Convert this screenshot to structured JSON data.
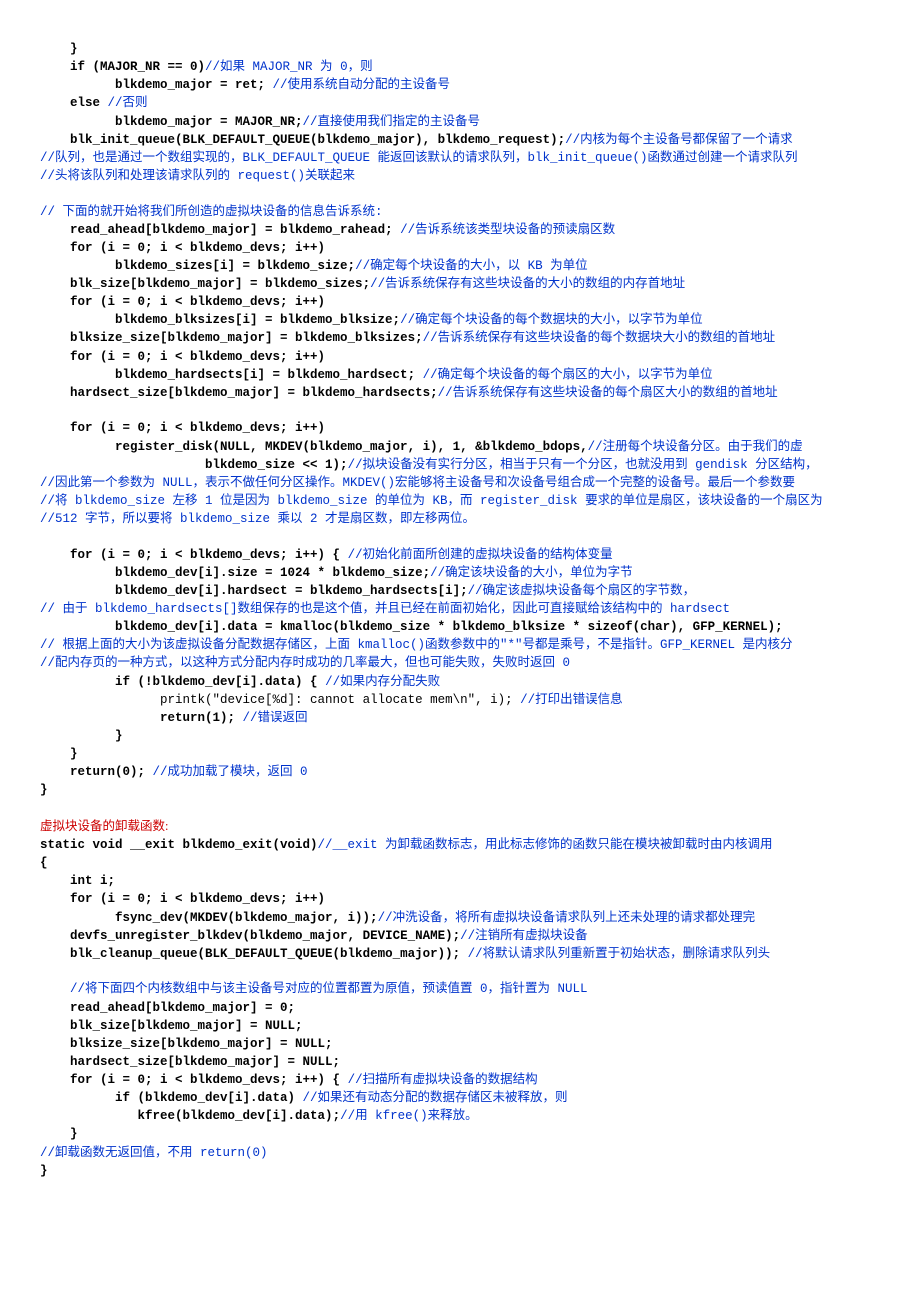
{
  "lines": [
    {
      "indent": 4,
      "parts": [
        {
          "t": "kw",
          "v": "}"
        }
      ]
    },
    {
      "indent": 4,
      "parts": [
        {
          "t": "kw",
          "v": "if (MAJOR_NR == 0)"
        },
        {
          "t": "cm",
          "v": "//如果 MAJOR_NR 为 0，则"
        }
      ]
    },
    {
      "indent": 10,
      "parts": [
        {
          "t": "kw",
          "v": "blkdemo_major = ret; "
        },
        {
          "t": "cm",
          "v": "//使用系统自动分配的主设备号"
        }
      ]
    },
    {
      "indent": 4,
      "parts": [
        {
          "t": "kw",
          "v": "else "
        },
        {
          "t": "cm",
          "v": "//否则"
        }
      ]
    },
    {
      "indent": 10,
      "parts": [
        {
          "t": "kw",
          "v": "blkdemo_major = MAJOR_NR;"
        },
        {
          "t": "cm",
          "v": "//直接使用我们指定的主设备号"
        }
      ]
    },
    {
      "indent": 4,
      "parts": [
        {
          "t": "kw",
          "v": "blk_init_queue(BLK_DEFAULT_QUEUE(blkdemo_major), blkdemo_request);"
        },
        {
          "t": "cm",
          "v": "//内核为每个主设备号都保留了一个请求"
        }
      ]
    },
    {
      "indent": 0,
      "parts": [
        {
          "t": "cm",
          "v": "//队列，也是通过一个数组实现的，BLK_DEFAULT_QUEUE 能返回该默认的请求队列，blk_init_queue()函数通过创建一个请求队列"
        }
      ]
    },
    {
      "indent": 0,
      "parts": [
        {
          "t": "cm",
          "v": "//头将该队列和处理该请求队列的 request()关联起来"
        }
      ]
    },
    {
      "blank": true
    },
    {
      "indent": 0,
      "parts": [
        {
          "t": "cm",
          "v": "// 下面的就开始将我们所创造的虚拟块设备的信息告诉系统:"
        }
      ]
    },
    {
      "indent": 4,
      "parts": [
        {
          "t": "kw",
          "v": "read_ahead[blkdemo_major] = blkdemo_rahead; "
        },
        {
          "t": "cm",
          "v": "//告诉系统该类型块设备的预读扇区数"
        }
      ]
    },
    {
      "indent": 4,
      "parts": [
        {
          "t": "kw",
          "v": "for (i = 0; i < blkdemo_devs; i++)"
        }
      ]
    },
    {
      "indent": 10,
      "parts": [
        {
          "t": "kw",
          "v": "blkdemo_sizes[i] = blkdemo_size;"
        },
        {
          "t": "cm",
          "v": "//确定每个块设备的大小，以 KB 为单位"
        }
      ]
    },
    {
      "indent": 4,
      "parts": [
        {
          "t": "kw",
          "v": "blk_size[blkdemo_major] = blkdemo_sizes;"
        },
        {
          "t": "cm",
          "v": "//告诉系统保存有这些块设备的大小的数组的内存首地址"
        }
      ]
    },
    {
      "indent": 4,
      "parts": [
        {
          "t": "kw",
          "v": "for (i = 0; i < blkdemo_devs; i++)"
        }
      ]
    },
    {
      "indent": 10,
      "parts": [
        {
          "t": "kw",
          "v": "blkdemo_blksizes[i] = blkdemo_blksize;"
        },
        {
          "t": "cm",
          "v": "//确定每个块设备的每个数据块的大小，以字节为单位"
        }
      ]
    },
    {
      "indent": 4,
      "parts": [
        {
          "t": "kw",
          "v": "blksize_size[blkdemo_major] = blkdemo_blksizes;"
        },
        {
          "t": "cm",
          "v": "//告诉系统保存有这些块设备的每个数据块大小的数组的首地址"
        }
      ]
    },
    {
      "indent": 4,
      "parts": [
        {
          "t": "kw",
          "v": "for (i = 0; i < blkdemo_devs; i++)"
        }
      ]
    },
    {
      "indent": 10,
      "parts": [
        {
          "t": "kw",
          "v": "blkdemo_hardsects[i] = blkdemo_hardsect; "
        },
        {
          "t": "cm",
          "v": "//确定每个块设备的每个扇区的大小，以字节为单位"
        }
      ]
    },
    {
      "indent": 4,
      "parts": [
        {
          "t": "kw",
          "v": "hardsect_size[blkdemo_major] = blkdemo_hardsects;"
        },
        {
          "t": "cm",
          "v": "//告诉系统保存有这些块设备的每个扇区大小的数组的首地址"
        }
      ]
    },
    {
      "blank": true
    },
    {
      "indent": 4,
      "parts": [
        {
          "t": "kw",
          "v": "for (i = 0; i < blkdemo_devs; i++)"
        }
      ]
    },
    {
      "indent": 10,
      "parts": [
        {
          "t": "kw",
          "v": "register_disk(NULL, MKDEV(blkdemo_major, i), 1, &blkdemo_bdops,"
        },
        {
          "t": "cm",
          "v": "//注册每个块设备分区。由于我们的虚"
        }
      ]
    },
    {
      "indent": 22,
      "parts": [
        {
          "t": "kw",
          "v": "blkdemo_size << 1);"
        },
        {
          "t": "cm",
          "v": "//拟块设备没有实行分区，相当于只有一个分区，也就没用到 gendisk 分区结构，"
        }
      ]
    },
    {
      "indent": 0,
      "parts": [
        {
          "t": "cm",
          "v": "//因此第一个参数为 NULL，表示不做任何分区操作。MKDEV()宏能够将主设备号和次设备号组合成一个完整的设备号。最后一个参数要"
        }
      ]
    },
    {
      "indent": 0,
      "parts": [
        {
          "t": "cm",
          "v": "//将 blkdemo_size 左移 1 位是因为 blkdemo_size 的单位为 KB，而 register_disk 要求的单位是扇区，该块设备的一个扇区为"
        }
      ]
    },
    {
      "indent": 0,
      "parts": [
        {
          "t": "cm",
          "v": "//512 字节，所以要将 blkdemo_size 乘以 2 才是扇区数，即左移两位。"
        }
      ]
    },
    {
      "blank": true
    },
    {
      "indent": 4,
      "parts": [
        {
          "t": "kw",
          "v": "for (i = 0; i < blkdemo_devs; i++) { "
        },
        {
          "t": "cm",
          "v": "//初始化前面所创建的虚拟块设备的结构体变量"
        }
      ]
    },
    {
      "indent": 10,
      "parts": [
        {
          "t": "kw",
          "v": "blkdemo_dev[i].size = 1024 * blkdemo_size;"
        },
        {
          "t": "cm",
          "v": "//确定该块设备的大小，单位为字节"
        }
      ]
    },
    {
      "indent": 10,
      "parts": [
        {
          "t": "kw",
          "v": "blkdemo_dev[i].hardsect = blkdemo_hardsects[i];"
        },
        {
          "t": "cm",
          "v": "//确定该虚拟块设备每个扇区的字节数，"
        }
      ]
    },
    {
      "indent": 0,
      "parts": [
        {
          "t": "cm",
          "v": "// 由于 blkdemo_hardsects[]数组保存的也是这个值，并且已经在前面初始化，因此可直接赋给该结构中的 hardsect"
        }
      ]
    },
    {
      "indent": 10,
      "parts": [
        {
          "t": "kw",
          "v": "blkdemo_dev[i].data = kmalloc(blkdemo_size * blkdemo_blksize * sizeof(char), GFP_KERNEL);"
        }
      ]
    },
    {
      "indent": 0,
      "parts": [
        {
          "t": "cm",
          "v": "// 根据上面的大小为该虚拟设备分配数据存储区，上面 kmalloc()函数参数中的\"*\"号都是乘号，不是指针。GFP_KERNEL 是内核分"
        }
      ]
    },
    {
      "indent": 0,
      "parts": [
        {
          "t": "cm",
          "v": "//配内存页的一种方式，以这种方式分配内存时成功的几率最大，但也可能失败，失败时返回 0"
        }
      ]
    },
    {
      "indent": 10,
      "parts": [
        {
          "t": "kw",
          "v": "if (!blkdemo_dev[i].data) { "
        },
        {
          "t": "cm",
          "v": "//如果内存分配失败"
        }
      ]
    },
    {
      "indent": 16,
      "parts": [
        {
          "t": "txt",
          "v": "printk(\"device[%d]: cannot allocate mem\\n\", i); "
        },
        {
          "t": "cm",
          "v": "//打印出错误信息"
        }
      ]
    },
    {
      "indent": 16,
      "parts": [
        {
          "t": "kw",
          "v": "return(1); "
        },
        {
          "t": "cm",
          "v": "//错误返回"
        }
      ]
    },
    {
      "indent": 10,
      "parts": [
        {
          "t": "kw",
          "v": "}"
        }
      ]
    },
    {
      "indent": 4,
      "parts": [
        {
          "t": "kw",
          "v": "}"
        }
      ]
    },
    {
      "indent": 4,
      "parts": [
        {
          "t": "kw",
          "v": "return(0); "
        },
        {
          "t": "cm",
          "v": "//成功加载了模块，返回 0"
        }
      ]
    },
    {
      "indent": 0,
      "parts": [
        {
          "t": "kw",
          "v": "}"
        }
      ]
    },
    {
      "blank": true
    },
    {
      "indent": 0,
      "parts": [
        {
          "t": "red",
          "v": "虚拟块设备的卸载函数:"
        }
      ]
    },
    {
      "indent": 0,
      "parts": [
        {
          "t": "kw",
          "v": "static void __exit blkdemo_exit(void)"
        },
        {
          "t": "cm",
          "v": "//__exit 为卸载函数标志，用此标志修饰的函数只能在模块被卸载时由内核调用"
        }
      ]
    },
    {
      "indent": 0,
      "parts": [
        {
          "t": "kw",
          "v": "{"
        }
      ]
    },
    {
      "indent": 4,
      "parts": [
        {
          "t": "kw",
          "v": "int i;"
        }
      ]
    },
    {
      "indent": 4,
      "parts": [
        {
          "t": "kw",
          "v": "for (i = 0; i < blkdemo_devs; i++)"
        }
      ]
    },
    {
      "indent": 10,
      "parts": [
        {
          "t": "kw",
          "v": "fsync_dev(MKDEV(blkdemo_major, i));"
        },
        {
          "t": "cm",
          "v": "//冲洗设备，将所有虚拟块设备请求队列上还未处理的请求都处理完"
        }
      ]
    },
    {
      "indent": 4,
      "parts": [
        {
          "t": "kw",
          "v": "devfs_unregister_blkdev(blkdemo_major, DEVICE_NAME);"
        },
        {
          "t": "cm",
          "v": "//注销所有虚拟块设备"
        }
      ]
    },
    {
      "indent": 4,
      "parts": [
        {
          "t": "kw",
          "v": "blk_cleanup_queue(BLK_DEFAULT_QUEUE(blkdemo_major)); "
        },
        {
          "t": "cm",
          "v": "//将默认请求队列重新置于初始状态，删除请求队列头"
        }
      ]
    },
    {
      "blank": true
    },
    {
      "indent": 4,
      "parts": [
        {
          "t": "cm",
          "v": "//将下面四个内核数组中与该主设备号对应的位置都置为原值，预读值置 0，指针置为 NULL"
        }
      ]
    },
    {
      "indent": 4,
      "parts": [
        {
          "t": "kw",
          "v": "read_ahead[blkdemo_major] = 0;"
        }
      ]
    },
    {
      "indent": 4,
      "parts": [
        {
          "t": "kw",
          "v": "blk_size[blkdemo_major] = NULL;"
        }
      ]
    },
    {
      "indent": 4,
      "parts": [
        {
          "t": "kw",
          "v": "blksize_size[blkdemo_major] = NULL;"
        }
      ]
    },
    {
      "indent": 4,
      "parts": [
        {
          "t": "kw",
          "v": "hardsect_size[blkdemo_major] = NULL;"
        }
      ]
    },
    {
      "indent": 4,
      "parts": [
        {
          "t": "kw",
          "v": "for (i = 0; i < blkdemo_devs; i++) { "
        },
        {
          "t": "cm",
          "v": "//扫描所有虚拟块设备的数据结构"
        }
      ]
    },
    {
      "indent": 10,
      "parts": [
        {
          "t": "kw",
          "v": "if (blkdemo_dev[i].data) "
        },
        {
          "t": "cm",
          "v": "//如果还有动态分配的数据存储区未被释放，则"
        }
      ]
    },
    {
      "indent": 13,
      "parts": [
        {
          "t": "kw",
          "v": "kfree(blkdemo_dev[i].data);"
        },
        {
          "t": "cm",
          "v": "//用 kfree()来释放。"
        }
      ]
    },
    {
      "indent": 4,
      "parts": [
        {
          "t": "kw",
          "v": "}"
        }
      ]
    },
    {
      "indent": 0,
      "parts": [
        {
          "t": "cm",
          "v": "//卸载函数无返回值，不用 return(0)"
        }
      ]
    },
    {
      "indent": 0,
      "parts": [
        {
          "t": "kw",
          "v": "}"
        }
      ]
    }
  ]
}
